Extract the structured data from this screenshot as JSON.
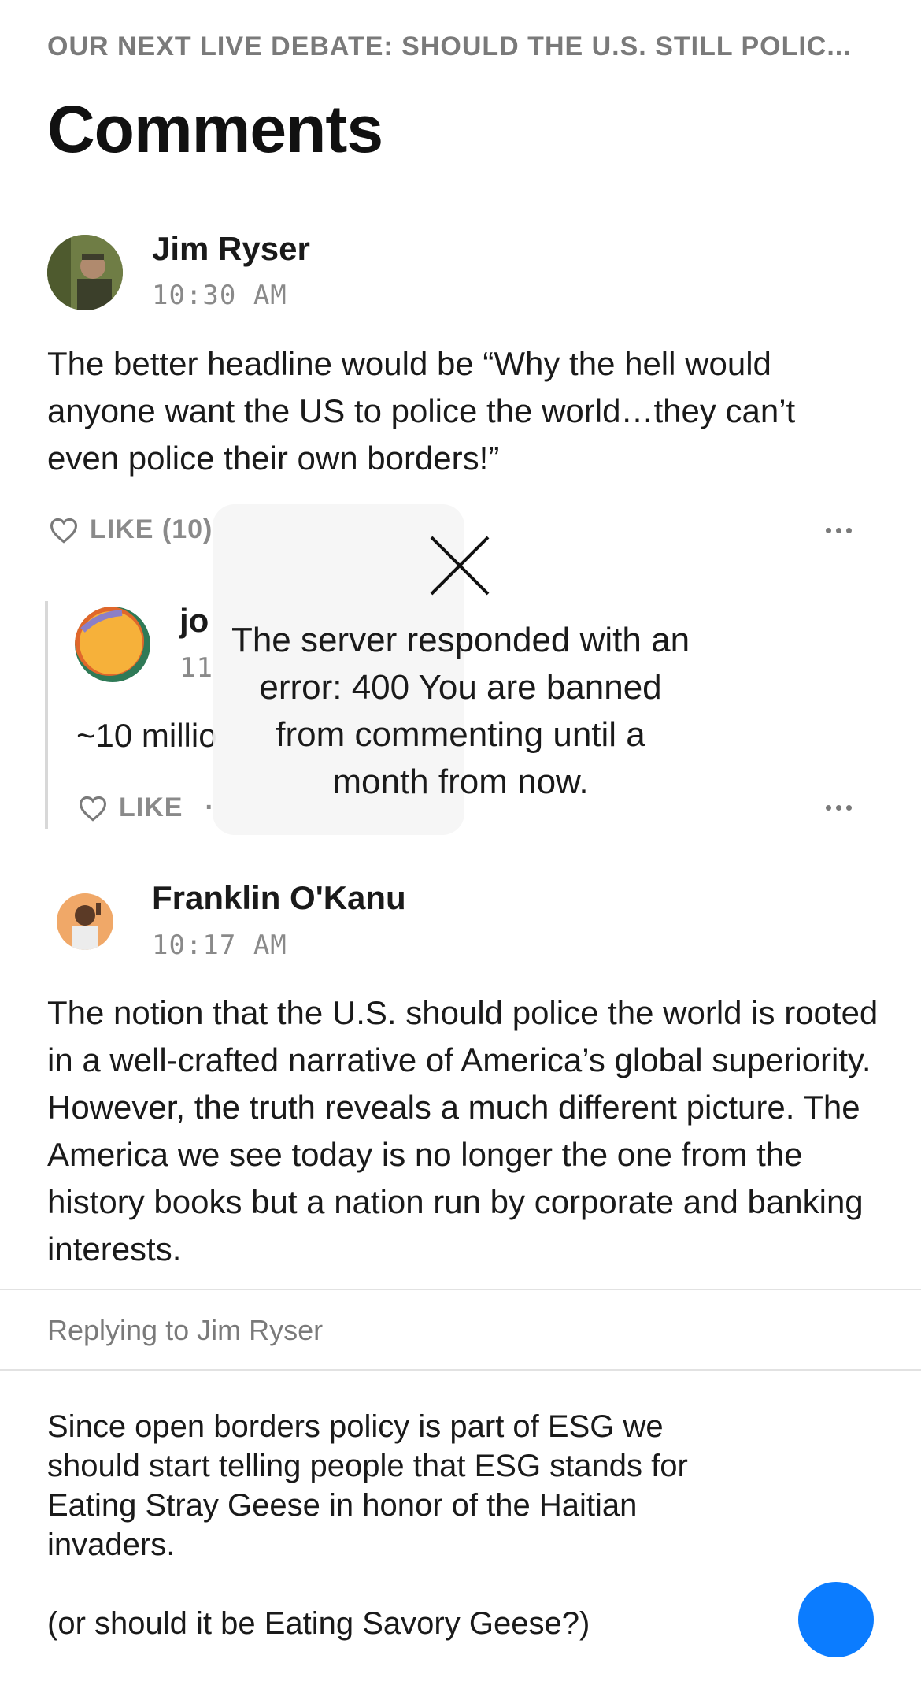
{
  "header": {
    "overline": "OUR NEXT LIVE DEBATE: SHOULD THE U.S. STILL POLIC...",
    "title": "Comments"
  },
  "comments": [
    {
      "author": "Jim Ryser",
      "time": "10:30 AM",
      "body": "The better headline would be “Why the hell would anyone want the US to police the world…they can’t even police their own borders!”",
      "like_label": "LIKE (10)"
    },
    {
      "author": "jo",
      "time": "11",
      "body": "~10 millio",
      "like_label": "LIKE",
      "separator": "·"
    },
    {
      "author": "Franklin O'Kanu",
      "time": "10:17 AM",
      "body": "The notion that the U.S. should police the world is rooted in a well-crafted narrative of America’s global superiority. However, the truth reveals a much different picture. The America we see today is no longer the one from the history books but a nation run by corporate and banking interests."
    }
  ],
  "reply": {
    "replying_to": "Replying to Jim Ryser",
    "draft": "Since open borders policy is part of ESG we should start telling people that ESG stands for Eating Stray Geese in honor of the Haitian invaders.\n\n(or should it be Eating Savory Geese?)"
  },
  "error_toast": {
    "message": "The server responded with an error: 400 You are banned from commenting until a month from now."
  },
  "colors": {
    "accent": "#0b7cff",
    "muted": "#8a8a8a"
  },
  "icons": [
    "heart-icon",
    "more-icon",
    "close-icon",
    "send-button"
  ]
}
